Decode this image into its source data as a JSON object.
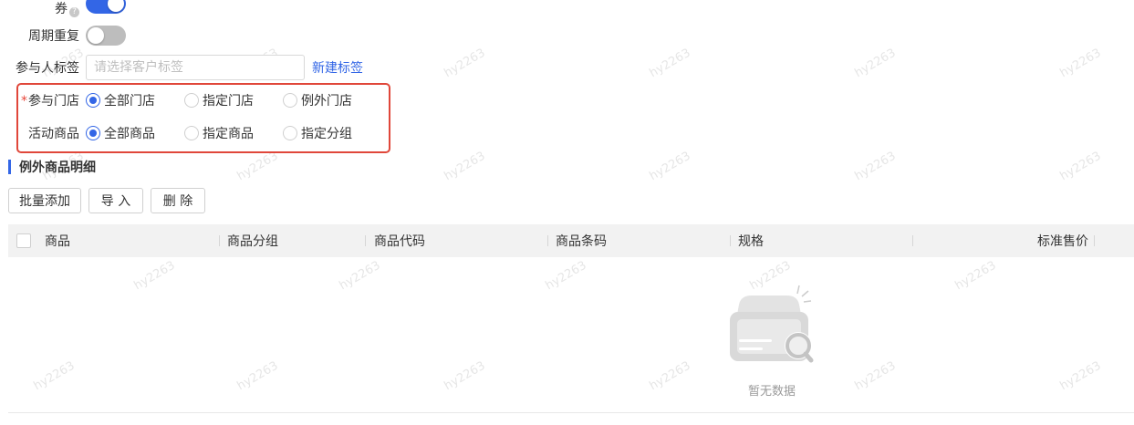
{
  "form": {
    "coupon": {
      "label_tail": "券",
      "help_icon": "help-icon",
      "switch_on": true
    },
    "repeat": {
      "label": "周期重复",
      "switch_on": false
    },
    "tag": {
      "label": "参与人标签",
      "placeholder": "请选择客户标签",
      "value": "",
      "link": "新建标签"
    },
    "stores": {
      "required_mark": "*",
      "label": "参与门店",
      "options": [
        "全部门店",
        "指定门店",
        "例外门店"
      ],
      "selected": 0
    },
    "products": {
      "label": "活动商品",
      "options": [
        "全部商品",
        "指定商品",
        "指定分组"
      ],
      "selected": 0
    }
  },
  "section": {
    "title": "例外商品明细"
  },
  "toolbar": {
    "batch_add": "批量添加",
    "import": "导 入",
    "delete": "删 除"
  },
  "table": {
    "columns": [
      "商品",
      "商品分组",
      "商品代码",
      "商品条码",
      "规格",
      "标准售价"
    ],
    "rows": []
  },
  "empty": {
    "text": "暂无数据",
    "icon": "empty-box-search-icon"
  },
  "watermark": {
    "text": "hy2263"
  },
  "colors": {
    "primary": "#3366e6",
    "highlight_border": "#e0473a",
    "required": "#e8463a",
    "header_bg": "#f2f2f2"
  }
}
